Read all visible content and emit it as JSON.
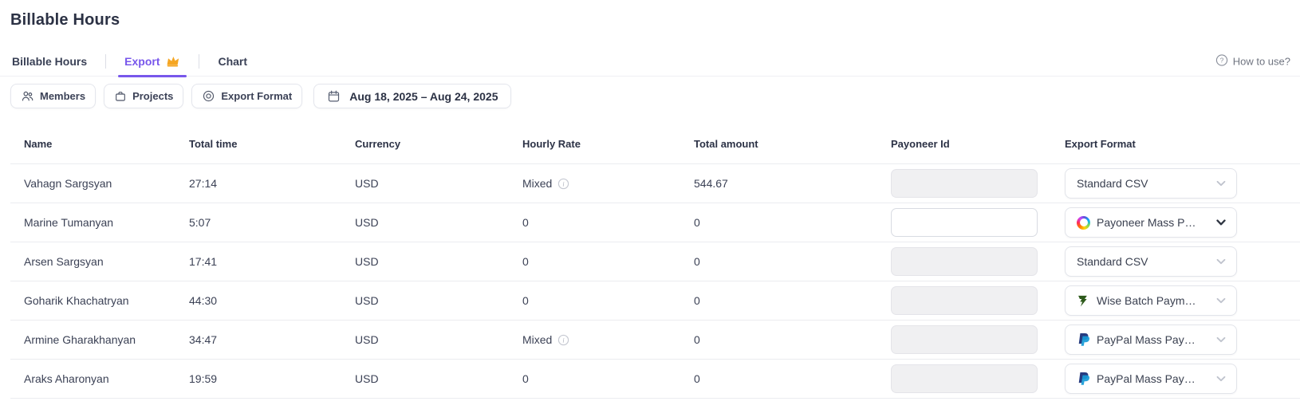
{
  "header": {
    "title": "Billable Hours",
    "help_label": "How to use?"
  },
  "tabs": {
    "billable_hours": "Billable Hours",
    "export": "Export",
    "chart": "Chart"
  },
  "filters": {
    "members": "Members",
    "projects": "Projects",
    "export_format": "Export Format",
    "date_range": "Aug 18, 2025 – Aug 24, 2025"
  },
  "table": {
    "headers": {
      "name": "Name",
      "total_time": "Total time",
      "currency": "Currency",
      "hourly_rate": "Hourly Rate",
      "total_amount": "Total amount",
      "payoneer_id": "Payoneer Id",
      "export_format": "Export Format"
    },
    "rows": [
      {
        "name": "Vahagn Sargsyan",
        "total_time": "27:14",
        "currency": "USD",
        "hourly_rate": "Mixed",
        "has_rate_info": true,
        "total_amount": "544.67",
        "payoneer_id": "",
        "payoneer_editable": false,
        "export_format": "Standard CSV",
        "format_icon": "none"
      },
      {
        "name": "Marine Tumanyan",
        "total_time": "5:07",
        "currency": "USD",
        "hourly_rate": "0",
        "has_rate_info": false,
        "total_amount": "0",
        "payoneer_id": "",
        "payoneer_editable": true,
        "export_format": "Payoneer Mass P…",
        "format_icon": "payoneer"
      },
      {
        "name": "Arsen Sargsyan",
        "total_time": "17:41",
        "currency": "USD",
        "hourly_rate": "0",
        "has_rate_info": false,
        "total_amount": "0",
        "payoneer_id": "",
        "payoneer_editable": false,
        "export_format": "Standard CSV",
        "format_icon": "none"
      },
      {
        "name": "Goharik Khachatryan",
        "total_time": "44:30",
        "currency": "USD",
        "hourly_rate": "0",
        "has_rate_info": false,
        "total_amount": "0",
        "payoneer_id": "",
        "payoneer_editable": false,
        "export_format": "Wise Batch Paym…",
        "format_icon": "wise"
      },
      {
        "name": "Armine Gharakhanyan",
        "total_time": "34:47",
        "currency": "USD",
        "hourly_rate": "Mixed",
        "has_rate_info": true,
        "total_amount": "0",
        "payoneer_id": "",
        "payoneer_editable": false,
        "export_format": "PayPal Mass Pay…",
        "format_icon": "paypal"
      },
      {
        "name": "Araks Aharonyan",
        "total_time": "19:59",
        "currency": "USD",
        "hourly_rate": "0",
        "has_rate_info": false,
        "total_amount": "0",
        "payoneer_id": "",
        "payoneer_editable": false,
        "export_format": "PayPal Mass Pay…",
        "format_icon": "paypal"
      }
    ]
  },
  "colors": {
    "accent_purple": "#7857eb",
    "crown_orange": "#f5a623",
    "paypal_dark": "#253b80",
    "paypal_light": "#179bd7",
    "wise_green": "#2d5a1b",
    "text_dark": "#2c3246",
    "text_body": "#3b4155",
    "row_border": "#ebecf0"
  }
}
